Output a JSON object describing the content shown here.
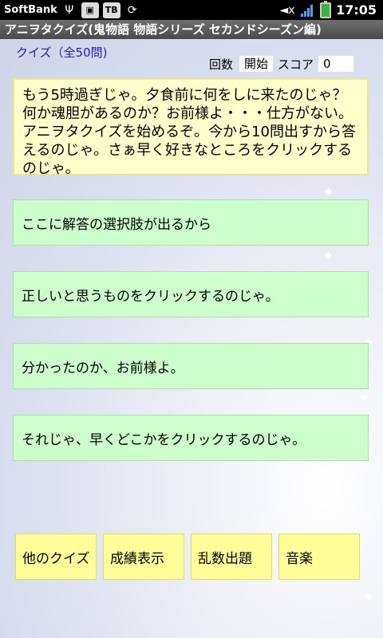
{
  "status": {
    "carrier": "SoftBank",
    "time": "17:05",
    "icons": [
      "usb-icon",
      "android-debug-icon",
      "tb-icon",
      "sync-icon",
      "mute-icon",
      "signal-icon",
      "battery-icon"
    ]
  },
  "app": {
    "title": "アニヲタクイズ(鬼物語 物語シリーズ セカンドシーズン編)"
  },
  "quiz": {
    "label": "クイズ（全50問)",
    "count_label": "回数",
    "count_value": "開始",
    "score_label": "スコア",
    "score_value": "0"
  },
  "message": "もう5時過ぎじゃ。夕食前に何をしに来たのじゃ？何か魂胆があるのか？お前様よ・・・仕方がない。アニヲタクイズを始めるぞ。今から10問出すから答えるのじゃ。さぁ早く好きなところをクリックするのじゃ。",
  "answers": [
    "ここに解答の選択肢が出るから",
    "正しいと思うものをクリックするのじゃ。",
    "分かったのか、お前様よ。",
    "それじゃ、早くどこかをクリックするのじゃ。"
  ],
  "buttons": {
    "other_quiz": "他のクイズ",
    "results": "成績表示",
    "random": "乱数出題",
    "music": "音楽"
  }
}
